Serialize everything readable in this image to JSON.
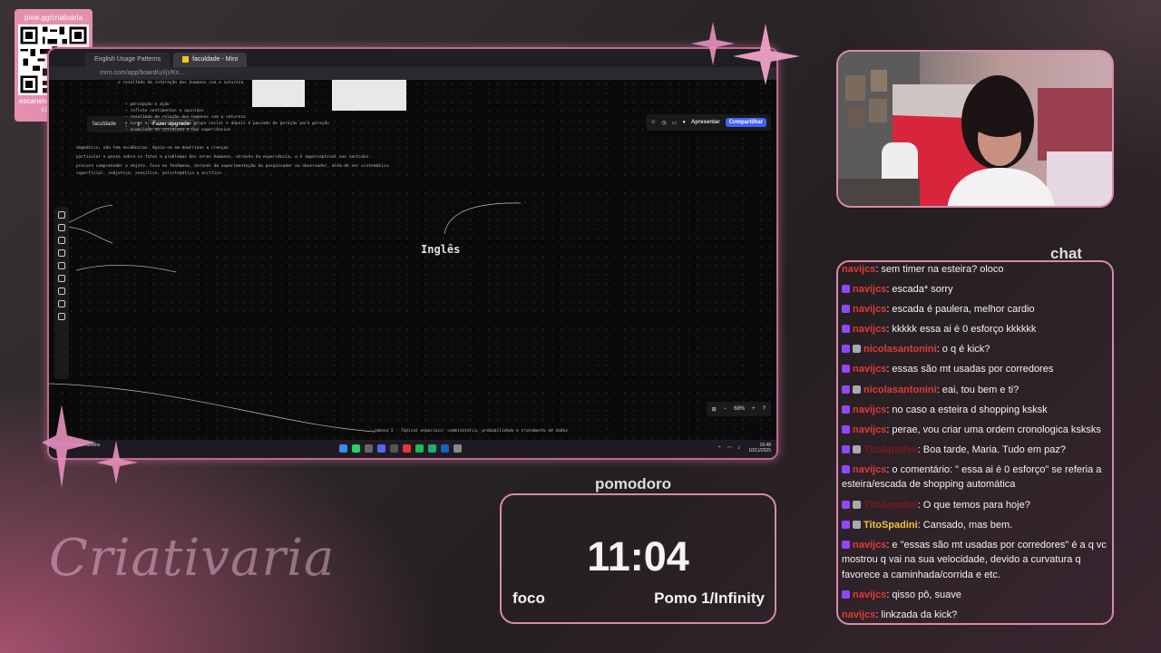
{
  "qr": {
    "url": "pixie.gg/criativaria",
    "caption": "escaneie pelo app da câmera"
  },
  "screen": {
    "tabs": [
      {
        "label": "English Usage Patterns",
        "active": false
      },
      {
        "label": "faculdade - Miro",
        "active": true
      }
    ],
    "address": "miro.com/app/board/uXjVKn...",
    "board_name": "faculdade",
    "upgrade_label": "Fazer upgrade",
    "present_label": "Apresentar",
    "share_label": "Compartilhar",
    "board_title": "Inglês",
    "zoom": "68%",
    "mind_map_lines": [
      "o resultado da interação dos humanos com a natureza",
      "— percepção e ação",
      "— reflete sentimentos e opiniões",
      "— resultado de relação dos humanos com a natureza",
      "— surge e se reproduz em um grupo social e depois é passado de geração para geração",
      "— acumulado no cotidiano e nas experiências",
      "dogmático, não tem evidências. Apoia-se em doutrinas e crenças",
      "particular e pensa sobre os fatos e problemas dos seres humanos, através da experiência, e é imperceptível aos sentidos",
      "procura compreender o objeto. Foca no fenômeno, através da experimentação do pesquisador ou observador, além de ser sistemático",
      "superficial, subjetivo, sensitivo, assistemático e acrítico"
    ],
    "footer_note": "semana 5 - Tópicos especiais: combinatória, probabilidade e tratamento de dados",
    "taskbar": {
      "weather": "24°C Sol com nuvens",
      "time": "16:48",
      "date": "10/11/2025"
    }
  },
  "chat": {
    "title": "chat",
    "messages": [
      {
        "user": "navijcs",
        "text": ": sem timer na esteira? oloco",
        "style": "red",
        "badge": false
      },
      {
        "user": "navijcs",
        "text": ": escada* sorry",
        "style": "red",
        "badge": true
      },
      {
        "user": "navijcs",
        "text": ": escada é paulera, melhor cardio",
        "style": "red",
        "badge": true
      },
      {
        "user": "navijcs",
        "text": ": kkkkk essa ai é 0 esforço kkkkkk",
        "style": "red",
        "badge": true
      },
      {
        "user": "nicolasantonini",
        "text": ": o q é kick?",
        "style": "red",
        "badge": true,
        "badge2": true
      },
      {
        "user": "navijcs",
        "text": ": essas são mt usadas por corredores",
        "style": "red",
        "badge": true
      },
      {
        "user": "nicolasantonini",
        "text": ": eai, tou bem e ti?",
        "style": "red",
        "badge": true,
        "badge2": true
      },
      {
        "user": "navijcs",
        "text": ": no caso a esteira d shopping ksksk",
        "style": "red",
        "badge": true
      },
      {
        "user": "navijcs",
        "text": ": perae, vou criar uma ordem cronologica ksksks",
        "style": "red",
        "badge": true
      },
      {
        "user": "TitoSpadini",
        "text": ": Boa tarde, Maria. Tudo em paz?",
        "style": "dark",
        "badge": true,
        "badge2": true
      },
      {
        "user": "navijcs",
        "text": ": o comentário: \" essa ai é 0 esforço\" se referia a esteira/escada de shopping automática",
        "style": "red",
        "badge": true
      },
      {
        "user": "TitoSpadini",
        "text": ": O que temos para hoje?",
        "style": "dark",
        "badge": true,
        "badge2": true
      },
      {
        "user": "TitoSpadini",
        "text": ": Cansado, mas bem.",
        "style": "yellow",
        "badge": true,
        "badge2": true
      },
      {
        "user": "navijcs",
        "text": ": e \"essas são mt usadas por corredores\" é a q vc mostrou q vai na sua velocidade, devido a curvatura q favorece a caminhada/corrida e etc.",
        "style": "red",
        "badge": true
      },
      {
        "user": "navijcs",
        "text": ": qisso pô, suave",
        "style": "red",
        "badge": true
      },
      {
        "user": "navijcs",
        "text": ": linkzada da kick?",
        "style": "red",
        "badge": false
      }
    ]
  },
  "pomodoro": {
    "title": "pomodoro",
    "time": "11:04",
    "mode": "foco",
    "count": "Pomo 1/Infinity"
  },
  "brand": "Criativaria",
  "colors": {
    "accent_pink": "#d889aa",
    "chat_user_red": "#e03a3a",
    "chat_user_yellow": "#f0c43a"
  }
}
